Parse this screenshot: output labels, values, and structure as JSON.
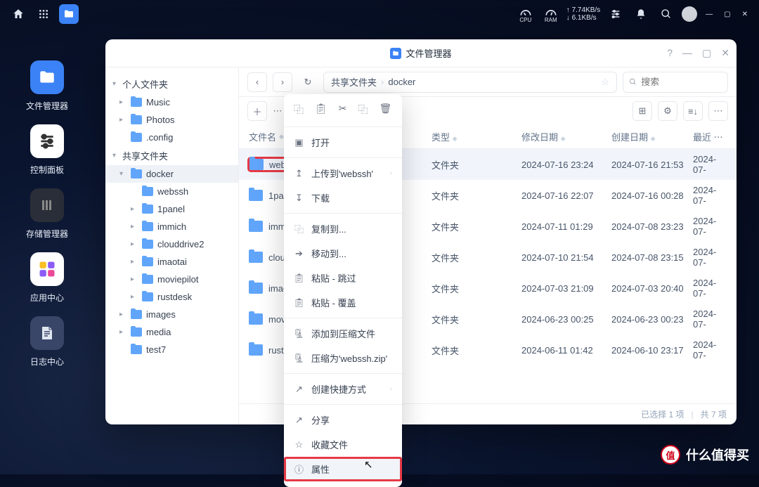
{
  "taskbar": {
    "net_up": "↑ 7.74KB/s",
    "net_down": "↓ 6.1KB/s",
    "cpu_label": "CPU",
    "ram_label": "RAM"
  },
  "dock": [
    {
      "label": "文件管理器"
    },
    {
      "label": "控制面板"
    },
    {
      "label": "存储管理器"
    },
    {
      "label": "应用中心"
    },
    {
      "label": "日志中心"
    }
  ],
  "window": {
    "title": "文件管理器",
    "help": "?",
    "breadcrumb": [
      "共享文件夹",
      "docker"
    ],
    "search_placeholder": "搜索"
  },
  "sidebar": {
    "group_personal": "个人文件夹",
    "group_shared": "共享文件夹",
    "personal": [
      "Music",
      "Photos",
      ".config"
    ],
    "shared_root": "docker",
    "docker_children": [
      "webssh",
      "1panel",
      "immich",
      "clouddrive2",
      "imaotai",
      "moviepilot",
      "rustdesk"
    ],
    "shared_siblings": [
      "images",
      "media",
      "test7"
    ]
  },
  "columns": {
    "name": "文件名",
    "type": "类型",
    "modified": "修改日期",
    "created": "创建日期",
    "last": "最近"
  },
  "type_folder": "文件夹",
  "rows": [
    {
      "name": "webssh",
      "mod": "2024-07-16 23:24",
      "cre": "2024-07-16 21:53",
      "last": "2024-07-"
    },
    {
      "name": "1panel",
      "mod": "2024-07-16 22:07",
      "cre": "2024-07-16 00:28",
      "last": "2024-07-"
    },
    {
      "name": "immich",
      "mod": "2024-07-11 01:29",
      "cre": "2024-07-08 23:23",
      "last": "2024-07-"
    },
    {
      "name": "clouddrive2",
      "mod": "2024-07-10 21:54",
      "cre": "2024-07-08 23:15",
      "last": "2024-07-"
    },
    {
      "name": "imaotai",
      "mod": "2024-07-03 21:09",
      "cre": "2024-07-03 20:40",
      "last": "2024-07-"
    },
    {
      "name": "moviepilot",
      "mod": "2024-06-23 00:25",
      "cre": "2024-06-23 00:23",
      "last": "2024-07-"
    },
    {
      "name": "rustdesk",
      "mod": "2024-06-11 01:42",
      "cre": "2024-06-10 23:17",
      "last": "2024-07-"
    }
  ],
  "status": {
    "sel": "已选择 1 项",
    "total": "共 7 项"
  },
  "ctx": {
    "open": "打开",
    "upload_to": "上传到'webssh'",
    "download": "下载",
    "copy_to": "复制到...",
    "move_to": "移动到...",
    "paste_skip": "粘贴 - 跳过",
    "paste_over": "粘贴 - 覆盖",
    "add_zip": "添加到压缩文件",
    "zip_as": "压缩为'webssh.zip'",
    "shortcut": "创建快捷方式",
    "share": "分享",
    "favorite": "收藏文件",
    "properties": "属性"
  },
  "watermark": "什么值得买"
}
